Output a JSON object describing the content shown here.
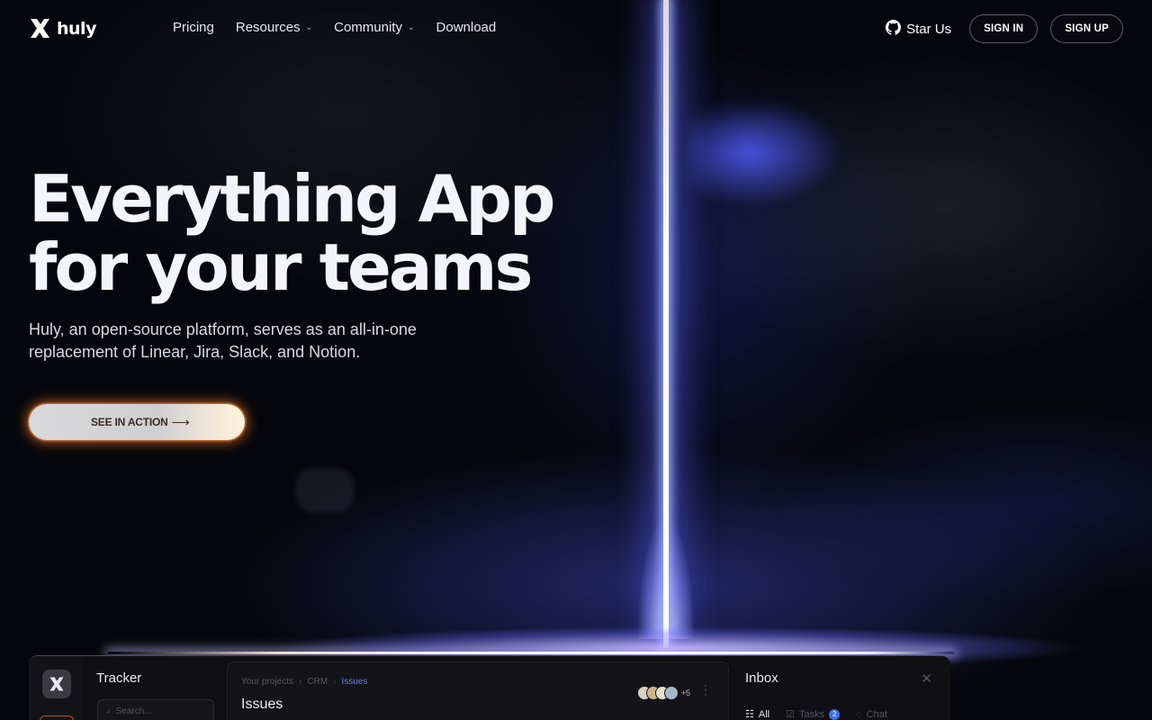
{
  "nav": {
    "brand": "huly",
    "links": [
      {
        "label": "Pricing",
        "has_menu": false
      },
      {
        "label": "Resources",
        "has_menu": true
      },
      {
        "label": "Community",
        "has_menu": true
      },
      {
        "label": "Download",
        "has_menu": false
      }
    ],
    "star_label": "Star Us",
    "sign_in": "SIGN IN",
    "sign_up": "SIGN UP"
  },
  "hero": {
    "title_line1": "Everything App",
    "title_line2": "for your teams",
    "subtitle": "Huly, an open-source platform, serves as an all-in-one replacement of Linear, Jira, Slack, and Notion.",
    "cta_label": "SEE IN ACTION",
    "cta_arrow": "⟶"
  },
  "preview": {
    "sidebar_title": "Tracker",
    "search_placeholder": "Search...",
    "breadcrumbs": [
      "Your projects",
      "CRM",
      "Issues"
    ],
    "page_title": "Issues",
    "avatar_more": "+5",
    "avatar_colors": [
      "#d8d0c0",
      "#c9b58a",
      "#e6e0d2",
      "#a9b8c8"
    ],
    "inbox": {
      "title": "Inbox",
      "tabs": [
        {
          "label": "All",
          "badge": null,
          "active": true
        },
        {
          "label": "Tasks",
          "badge": "2",
          "active": false
        },
        {
          "label": "Chat",
          "badge": null,
          "active": false
        }
      ]
    }
  },
  "colors": {
    "accent_blue": "#3f6fe0",
    "cta_glow": "#ff7828",
    "beam": "#ffffff"
  }
}
